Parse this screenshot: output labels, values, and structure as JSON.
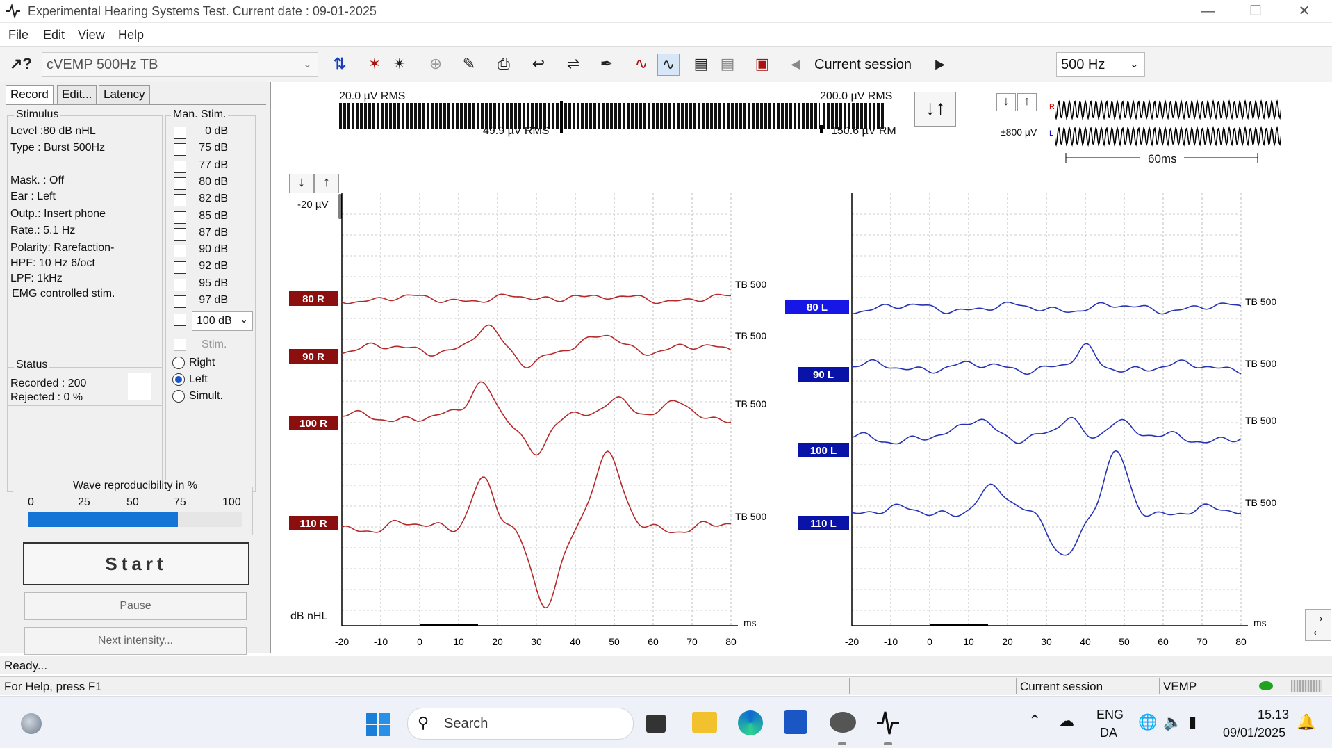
{
  "window": {
    "title": "Experimental Hearing Systems Test. Current date : 09-01-2025"
  },
  "menu": [
    "File",
    "Edit",
    "View",
    "Help"
  ],
  "toolbar": {
    "protocol": "cVEMP 500Hz TB",
    "session_label": "Current session",
    "frequency": "500 Hz"
  },
  "tabs": [
    "Record",
    "Edit...",
    "Latency"
  ],
  "stimulus": {
    "title": "Stimulus",
    "level": "Level :80 dB nHL",
    "type": "Type : Burst 500Hz",
    "mask": "Mask. : Off",
    "ear": "Ear :    Left",
    "outp": "Outp.: Insert phone",
    "rate": "Rate.:  5.1 Hz",
    "polarity": "Polarity:   Rarefaction-",
    "hpf": "HPF:      10 Hz 6/oct",
    "lpf": "LPF:       1kHz",
    "emg": "EMG controlled stim."
  },
  "man_stim": {
    "title": "Man. Stim.",
    "levels": [
      "0 dB",
      "75 dB",
      "77 dB",
      "80 dB",
      "82 dB",
      "85 dB",
      "87 dB",
      "90 dB",
      "92 dB",
      "95 dB",
      "97 dB"
    ],
    "dropdown": "100 dB",
    "stim_label": "Stim.",
    "right": "Right",
    "left": "Left",
    "simult": "Simult."
  },
  "status": {
    "title": "Status",
    "recorded": "Recorded :  200",
    "rejected": "Rejected :   0 %"
  },
  "reproducibility": {
    "title": "Wave reproducibility in %",
    "ticks": [
      "0",
      "25",
      "50",
      "75",
      "100"
    ],
    "value_percent": 70
  },
  "buttons": {
    "start": "Start",
    "pause": "Pause",
    "next": "Next intensity..."
  },
  "meter": {
    "left_top": "20.0 µV RMS",
    "right_top": "200.0 µV RMS",
    "left_bottom": "49.9 µV RMS",
    "right_bottom": "150.6 µV RM"
  },
  "stimulus_preview": {
    "scale": "±800 µV",
    "duration": "60ms",
    "r": "R",
    "l": "L"
  },
  "plots": {
    "scale": "-20 µV",
    "y_unit": "dB nHL",
    "x_unit": "ms",
    "x_ticks": [
      "-20",
      "-10",
      "0",
      "10",
      "20",
      "30",
      "40",
      "50",
      "60",
      "70",
      "80"
    ],
    "right_labels": [
      "80 R",
      "90 R",
      "100 R",
      "110 R"
    ],
    "left_labels": [
      "80 L",
      "90 L",
      "100 L",
      "110 L"
    ],
    "trace_label": "TB 500"
  },
  "statusbar": {
    "line1": "Ready...",
    "help": "For Help, press F1",
    "session": "Current session",
    "mode": "VEMP"
  },
  "taskbar": {
    "search": "Search",
    "lang1": "ENG",
    "lang2": "DA",
    "time": "15.13",
    "date": "09/01/2025"
  },
  "colors": {
    "right": "#b52a2a",
    "left": "#2633b3",
    "label_right": "#8b0f0f",
    "label_left": "#0a13a8"
  }
}
